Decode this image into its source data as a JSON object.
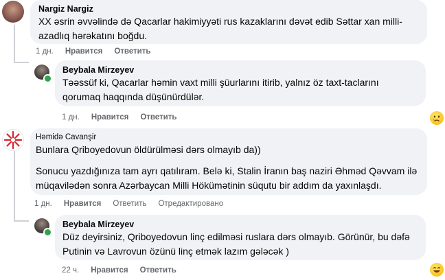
{
  "comments": [
    {
      "author": "Nargiz Nargiz",
      "lines": [
        "XX əsrin əvvəlində də Qacarlar hakimiyyəti rus kazaklarını dəvət edib Səttar xan milli-",
        "azadlıq hərəkatını boğdu."
      ],
      "time": "1 дн.",
      "like": "Нравится",
      "reply": "Ответить"
    },
    {
      "author": "Beybala Mirzeyev",
      "lines": [
        "Təəssüf ki, Qacarlar həmin vaxt milli şüurlarını itirib, yalnız öz taxt-taclarını",
        "qorumaq haqqında düşünürdülər."
      ],
      "time": "1 дн.",
      "like": "Нравится",
      "reply": "Ответить",
      "reaction": "crying-face"
    },
    {
      "author": "Həmidə Cavanşir",
      "lines": [
        "Bunlara Qriboyedovun öldürülməsi dərs olmayıb da))"
      ],
      "lines2": [
        "Sonucu yazdığınıza tam ayrı qatılıram. Belə ki, Stalin İranın baş naziri Əhməd Qəvvam ilə",
        "müqavilədən sonra Azərbaycan Milli Hökümətinin süqutu bir addım da yaxınlaşdı."
      ],
      "time": "1 дн.",
      "like": "Нравится",
      "reply": "Ответить",
      "edited": "Отредактировано"
    },
    {
      "author": "Beybala Mirzeyev",
      "lines": [
        "Düz deyirsiniz, Qriboyedovun linç edilməsi ruslara dərs olmayıb. Görünür, bu dəfə",
        "Putinin və Lavrovun özünü linç etmək lazım gələcək )"
      ],
      "time": "22 ч.",
      "like": "Нравится",
      "reply": "Ответить",
      "reaction": "laughing-face"
    }
  ],
  "colors": {
    "bubble": "#f0f2f5",
    "meta": "#65676b",
    "online": "#31a24c"
  }
}
